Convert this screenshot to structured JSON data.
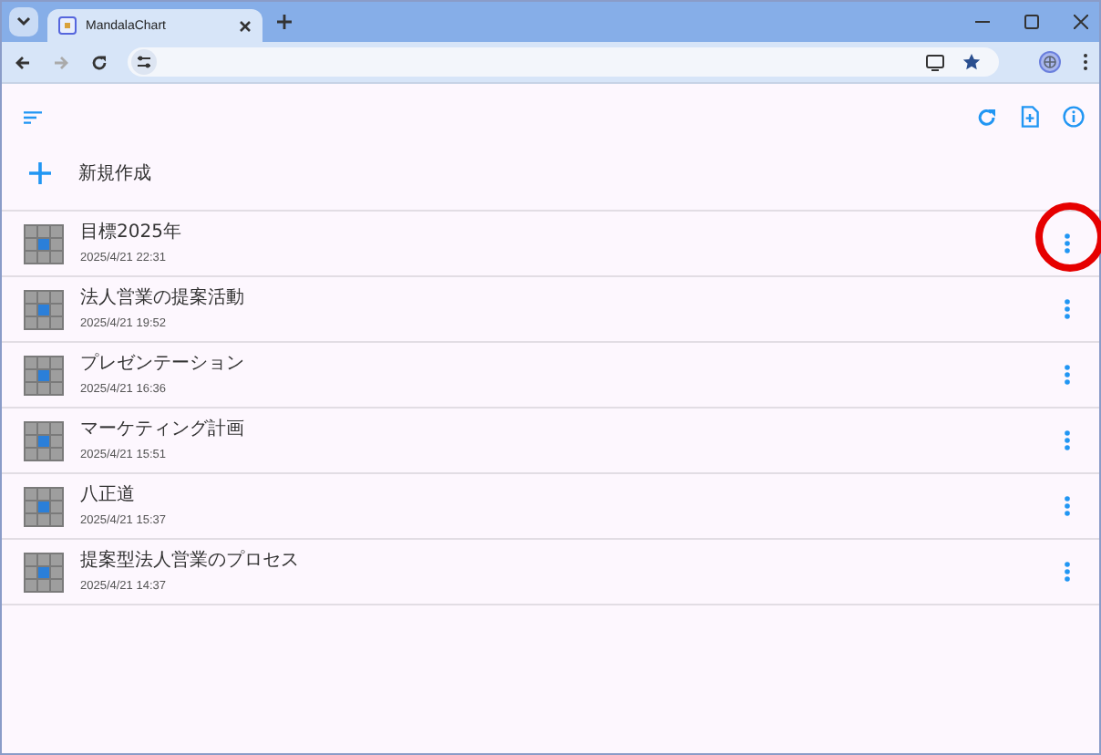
{
  "browser": {
    "tab_title": "MandalaChart"
  },
  "new_button": {
    "label": "新規作成"
  },
  "charts": [
    {
      "title": "目標2025年",
      "date": "2025/4/21 22:31",
      "circled": true
    },
    {
      "title": "法人営業の提案活動",
      "date": "2025/4/21 19:52",
      "circled": false
    },
    {
      "title": "プレゼンテーション",
      "date": "2025/4/21 16:36",
      "circled": false
    },
    {
      "title": "マーケティング計画",
      "date": "2025/4/21 15:51",
      "circled": false
    },
    {
      "title": "八正道",
      "date": "2025/4/21 15:37",
      "circled": false
    },
    {
      "title": "提案型法人営業のプロセス",
      "date": "2025/4/21 14:37",
      "circled": false
    }
  ]
}
